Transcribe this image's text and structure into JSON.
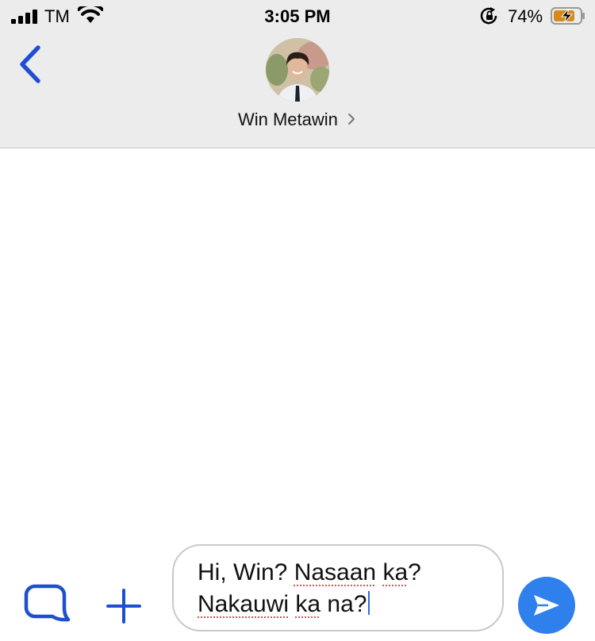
{
  "status_bar": {
    "carrier": "TM",
    "time": "3:05 PM",
    "battery_percent": "74%",
    "icons": [
      "signal-icon",
      "wifi-icon",
      "orientation-lock-icon",
      "battery-charging-icon"
    ]
  },
  "header": {
    "back_icon": "back-chevron-icon",
    "contact_name": "Win Metawin",
    "name_chevron_icon": "chevron-right-icon"
  },
  "composer": {
    "sticker_icon": "chat-bubble-icon",
    "add_icon": "plus-icon",
    "input_line1_a": "Hi, Win? ",
    "input_line1_b": "Nasaan",
    "input_line1_c": " ",
    "input_line1_d": "ka",
    "input_line1_e": "?",
    "input_line2_a": "Nakauwi",
    "input_line2_b": " ",
    "input_line2_c": "ka",
    "input_line2_d": " na?",
    "send_icon": "send-arrow-icon"
  },
  "colors": {
    "accent": "#2f80ed",
    "back_chevron": "#1f4fd1",
    "header_bg": "#ececec",
    "battery_fill": "#d68a1c"
  }
}
